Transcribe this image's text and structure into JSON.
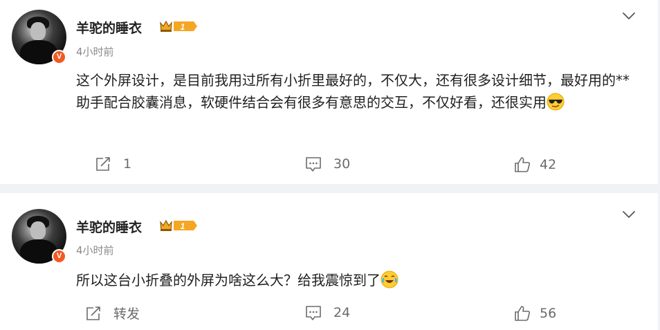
{
  "comments": [
    {
      "user_name": "羊驼的睡衣",
      "level_badge": "1",
      "verified_badge": "V",
      "time": "4小时前",
      "text": "这个外屏设计，是目前我用过所有小折里最好的，不仅大，还有很多设计细节，最好用的**助手配合胶囊消息，软硬件结合会有很多有意思的交互，不仅好看，还很实用",
      "emoji": "cool-sunglasses",
      "repost_label": "1",
      "comment_count": "30",
      "like_count": "42"
    },
    {
      "user_name": "羊驼的睡衣",
      "level_badge": "1",
      "verified_badge": "V",
      "time": "4小时前",
      "text": "所以这台小折叠的外屏为啥这么大？给我震惊到了",
      "emoji": "laugh-cry",
      "repost_label": "转发",
      "comment_count": "24",
      "like_count": "56"
    }
  ],
  "colors": {
    "text": "#1f1f1f",
    "meta": "#8a8a8a",
    "badge": "#f15a22",
    "crown": "#f5a623",
    "action": "#6b6b6b",
    "background": "#f1f2f5"
  }
}
